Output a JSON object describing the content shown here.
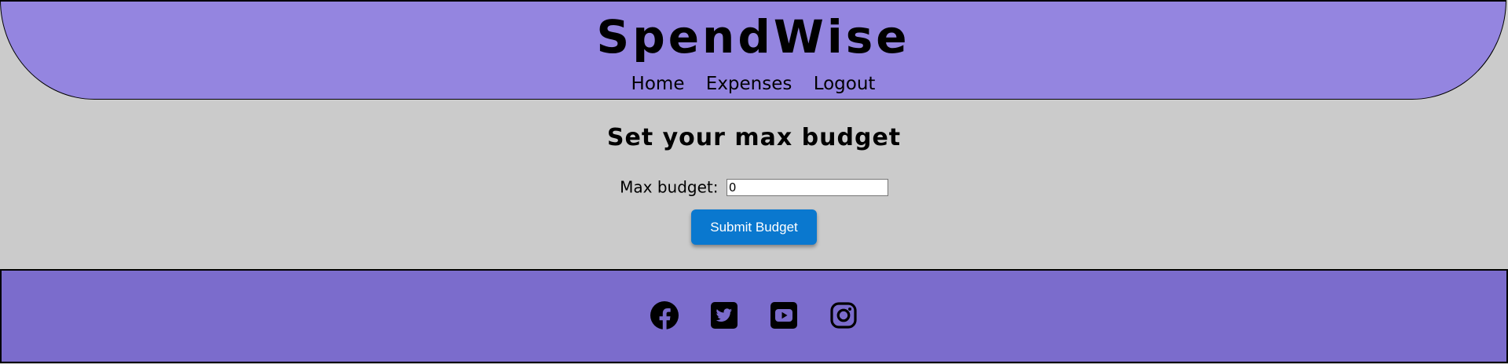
{
  "header": {
    "brand": "SpendWise",
    "nav": {
      "home": "Home",
      "expenses": "Expenses",
      "logout": "Logout"
    }
  },
  "main": {
    "title": "Set your max budget",
    "budget_label": "Max budget:",
    "budget_value": "0",
    "submit_label": "Submit Budget"
  },
  "footer": {
    "social_icons": [
      "facebook-icon",
      "twitter-icon",
      "youtube-icon",
      "instagram-icon"
    ]
  },
  "colors": {
    "page_background": "#cbcbcb",
    "header_background": "#9485e0",
    "footer_background": "#7b6ccc",
    "button_background": "#0a78cf",
    "button_text": "#ffffff"
  }
}
